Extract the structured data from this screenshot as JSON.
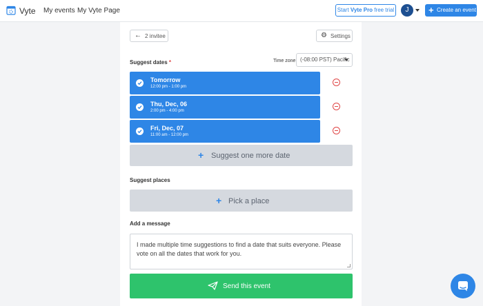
{
  "header": {
    "brand": "Vyte",
    "nav": [
      "My events",
      "My Vyte Page"
    ],
    "trial_prefix": "Start ",
    "trial_bold": "Vyte Pro",
    "trial_suffix": " free trial",
    "avatar_initial": "J",
    "create_label": "Create an event"
  },
  "toolbar": {
    "back_label": "2 invitee",
    "settings_label": "Settings"
  },
  "dates": {
    "label": "Suggest dates",
    "required_mark": "*",
    "timezone_label": "Time zone",
    "timezone_value": "(-08:00 PST) Pacific",
    "items": [
      {
        "title": "Tomorrow",
        "time": "12:00 pm - 1:00 pm"
      },
      {
        "title": "Thu, Dec, 06",
        "time": "2:00 pm - 4:00 pm"
      },
      {
        "title": "Fri, Dec, 07",
        "time": "11:00 am - 12:00 pm"
      }
    ],
    "add_label": "Suggest one more date"
  },
  "places": {
    "label": "Suggest places",
    "pick_label": "Pick a place"
  },
  "message": {
    "label": "Add a message",
    "value": "I made multiple time suggestions to find a date that suits everyone. Please vote on all the dates that work for you."
  },
  "send": {
    "label": "Send this event"
  },
  "colors": {
    "primary": "#2e86e6",
    "success": "#2ec36c",
    "danger": "#e04646"
  }
}
